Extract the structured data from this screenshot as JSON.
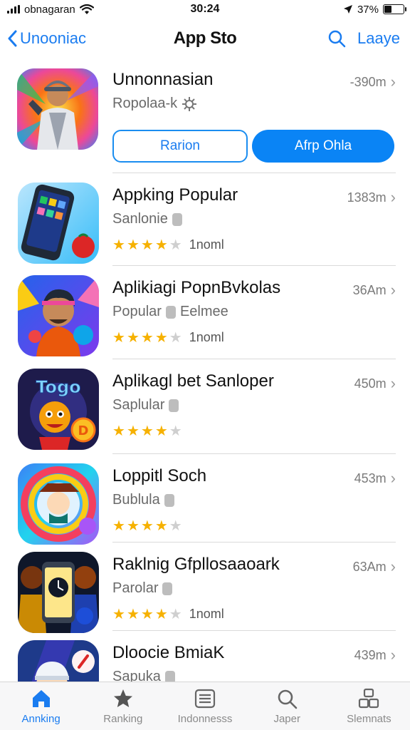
{
  "status_bar": {
    "carrier": "obnagaran",
    "time": "30:24",
    "battery": "37%",
    "battery_level": 0.37
  },
  "nav": {
    "back_label": "Unooniac",
    "title": "App Sto",
    "right_label": "Laaye"
  },
  "featured": {
    "name": "Unnonnasian",
    "subtitle": "Ropolaa-k",
    "size": "-390m",
    "button_outline": "Rarion",
    "button_filled": "Afrp Ohla"
  },
  "apps": [
    {
      "name": "Appking Popular",
      "subtitle": "Sanlonie",
      "size": "1383m",
      "rating": 4,
      "rating_label": "1noml"
    },
    {
      "name": "Aplikiagi PopnBvkolas",
      "subtitle": "Popular",
      "subtitle2": "Eelmee",
      "size": "36Am",
      "rating": 4,
      "rating_label": "1noml"
    },
    {
      "name": "Aplikagl bet Sanloper",
      "subtitle": "Saplular",
      "size": "450m",
      "rating": 4,
      "rating_label": ""
    },
    {
      "name": "Loppitl Soch",
      "subtitle": "Bublula",
      "size": "453m",
      "rating": 4,
      "rating_label": ""
    },
    {
      "name": "Raklnig Gfpllosaaoark",
      "subtitle": "Parolar",
      "size": "63Am",
      "rating": 4,
      "rating_label": "1noml"
    },
    {
      "name": "Dloocie BmiaK",
      "subtitle": "Sapuka",
      "size": "439m",
      "rating": 0,
      "rating_label": ""
    }
  ],
  "tabs": [
    {
      "label": "Annking",
      "icon": "home-icon",
      "active": true
    },
    {
      "label": "Ranking",
      "icon": "star-icon",
      "active": false
    },
    {
      "label": "Indonnesss",
      "icon": "list-icon",
      "active": false
    },
    {
      "label": "Japer",
      "icon": "search-icon",
      "active": false
    },
    {
      "label": "Slemnats",
      "icon": "apps-icon",
      "active": false
    }
  ],
  "colors": {
    "accent": "#1a7cf0",
    "button_fill": "#0a84f5",
    "star": "#f6b100"
  }
}
